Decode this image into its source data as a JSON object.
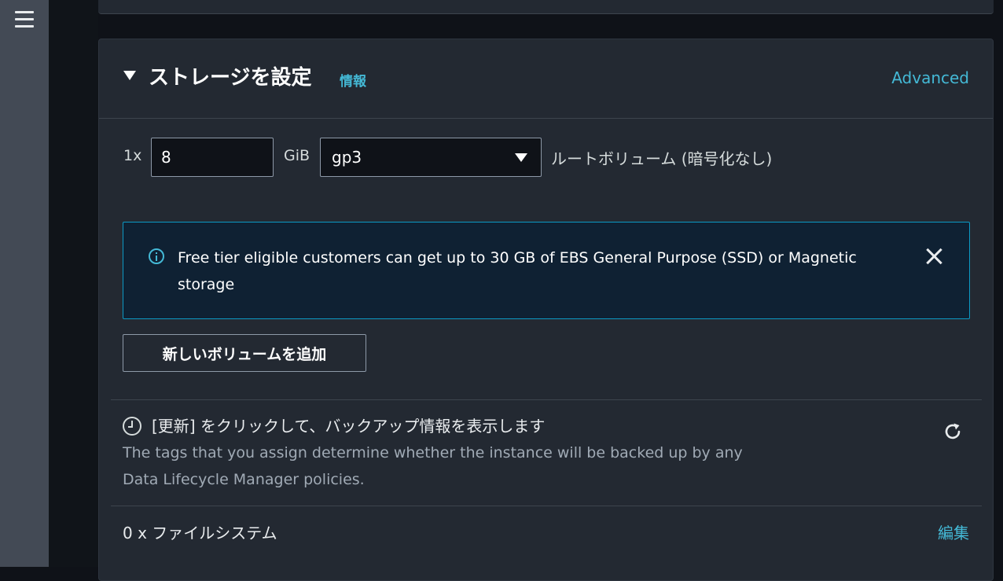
{
  "nav": {
    "menu_icon": "hamburger-menu-icon"
  },
  "storage": {
    "title": "ストレージを設定",
    "info_link": "情報",
    "advanced_link": "Advanced",
    "quantity_label": "1x",
    "size_value": "8",
    "unit_label": "GiB",
    "volume_type": "gp3",
    "volume_description": "ルートボリューム  (暗号化なし)",
    "alert_text": "Free tier eligible customers can get up to 30 GB of EBS General Purpose (SSD) or Magnetic storage",
    "add_volume_button": "新しいボリュームを追加",
    "backup_title": "[更新] をクリックして、バックアップ情報を表示します",
    "backup_description": "The tags that you assign determine whether the instance will be backed up by any Data Lifecycle Manager policies.",
    "filesystem_label": "0 x ファイルシステム",
    "edit_link": "編集"
  },
  "colors": {
    "link": "#44b9d6",
    "panel": "#232932",
    "alert_border": "#0c99c4",
    "alert_background": "#0f2133"
  },
  "icons": {
    "caret": "caret-down-icon",
    "info": "info-circle-icon",
    "close": "close-icon",
    "dropdown": "dropdown-arrow-icon",
    "clock": "clock-icon",
    "refresh": "refresh-icon"
  }
}
